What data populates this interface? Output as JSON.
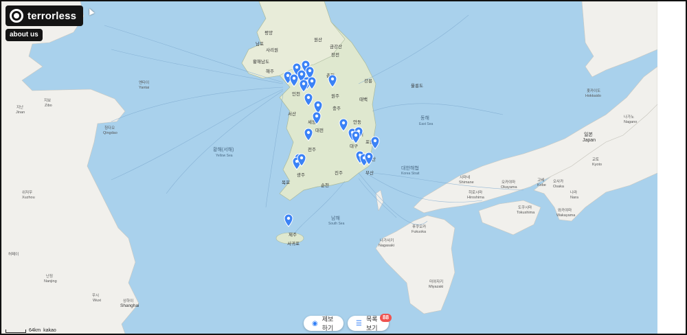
{
  "app": {
    "brand_name": "terrorless",
    "about_label": "about us",
    "report_label": "제보하기",
    "list_label": "목록 보기",
    "list_count": "88"
  },
  "map": {
    "attribution": "kakao",
    "scale": "64km",
    "colors": {
      "sea": "#a9d1ec",
      "land": "#f2f1ec",
      "korea_land": "#dfe8cf",
      "pin": "#3b82f6",
      "route": "#7eaacf"
    },
    "labels": [
      {
        "text": "평양"
      },
      {
        "text": "남포"
      },
      {
        "text": "사리원"
      },
      {
        "text": "해주"
      },
      {
        "text": "황해남도"
      },
      {
        "text": "원산"
      },
      {
        "text": "금강산"
      },
      {
        "text": "장전"
      },
      {
        "text": "춘천"
      },
      {
        "text": "강릉"
      },
      {
        "text": "원주"
      },
      {
        "text": "태백"
      },
      {
        "text": "인천"
      },
      {
        "text": "서산"
      },
      {
        "text": "충주"
      },
      {
        "text": "세종"
      },
      {
        "text": "대전"
      },
      {
        "text": "안동"
      },
      {
        "text": "영덕"
      },
      {
        "text": "대구"
      },
      {
        "text": "전주"
      },
      {
        "text": "울산"
      },
      {
        "text": "광주"
      },
      {
        "text": "진주"
      },
      {
        "text": "부산"
      },
      {
        "text": "포항"
      },
      {
        "text": "순천"
      },
      {
        "text": "목포"
      },
      {
        "text": "제주"
      },
      {
        "text": "서귀포"
      },
      {
        "text": "울릉도"
      },
      {
        "text": "황해(서해)"
      },
      {
        "text": "Yellow Sea"
      },
      {
        "text": "남해"
      },
      {
        "text": "South Sea"
      },
      {
        "text": "동해"
      },
      {
        "text": "East Sea"
      },
      {
        "text": "대한해협"
      },
      {
        "text": "Korea Strait"
      },
      {
        "text": "일본"
      },
      {
        "text": "Japan"
      },
      {
        "text": "나가노"
      },
      {
        "text": "Nagano"
      },
      {
        "text": "교토"
      },
      {
        "text": "Kyoto"
      },
      {
        "text": "오사카"
      },
      {
        "text": "Osaka"
      },
      {
        "text": "나라"
      },
      {
        "text": "Nara"
      },
      {
        "text": "고베"
      },
      {
        "text": "Kobe"
      },
      {
        "text": "와카야마"
      },
      {
        "text": "Wakayama"
      },
      {
        "text": "도쿠시마"
      },
      {
        "text": "Tokushima"
      },
      {
        "text": "오카야마"
      },
      {
        "text": "Okayama"
      },
      {
        "text": "히로시마"
      },
      {
        "text": "Hiroshima"
      },
      {
        "text": "시마네"
      },
      {
        "text": "Shimane"
      },
      {
        "text": "후쿠오카"
      },
      {
        "text": "Fukuoka"
      },
      {
        "text": "나가사키"
      },
      {
        "text": "Nagasaki"
      },
      {
        "text": "미야자키"
      },
      {
        "text": "Miyazaki"
      },
      {
        "text": "상하이"
      },
      {
        "text": "Shanghai"
      },
      {
        "text": "난징"
      },
      {
        "text": "Nanjing"
      },
      {
        "text": "우시"
      },
      {
        "text": "Wuxi"
      },
      {
        "text": "지난"
      },
      {
        "text": "Jinan"
      },
      {
        "text": "지보"
      },
      {
        "text": "Zibo"
      },
      {
        "text": "옌타이"
      },
      {
        "text": "Yantai"
      },
      {
        "text": "칭다오"
      },
      {
        "text": "Qingdao"
      },
      {
        "text": "쉬저우"
      },
      {
        "text": "Xuzhou"
      },
      {
        "text": "허페이"
      },
      {
        "text": "홋카이도"
      },
      {
        "text": "Hokkaido"
      }
    ]
  }
}
